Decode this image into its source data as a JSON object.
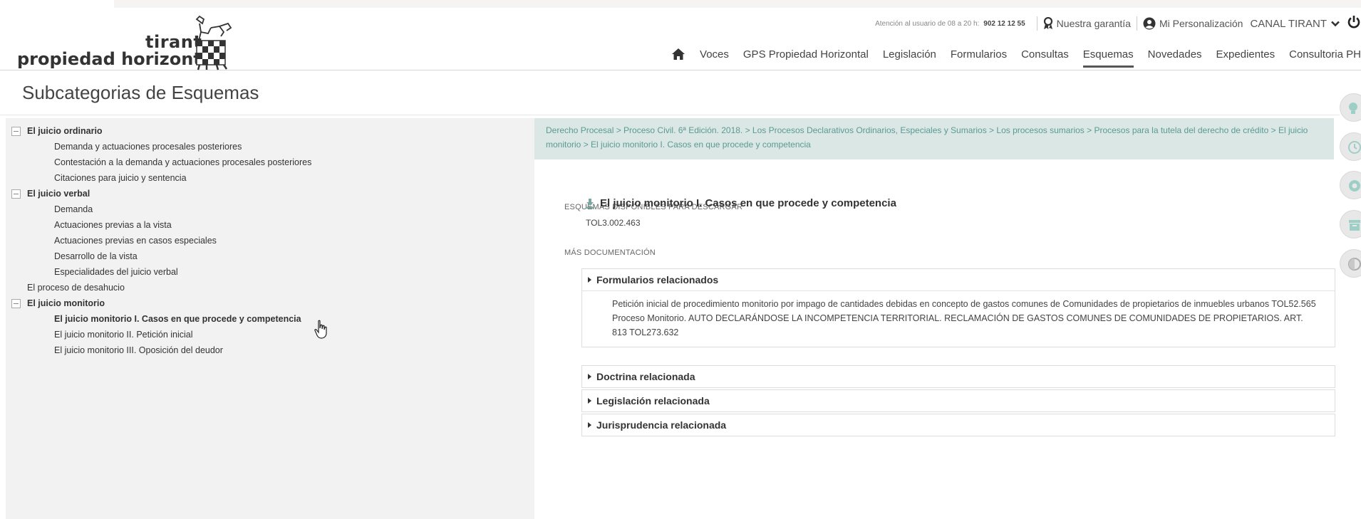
{
  "brand": {
    "line1": "tirant",
    "line2": "propiedad horizontal"
  },
  "utility": {
    "attention": "Atención al usuario de 08 a 20 h:",
    "phone": "902 12 12 55",
    "guarantee": "Nuestra garantía",
    "personalization": "Mi Personalización",
    "canal": "CANAL TIRANT"
  },
  "nav": {
    "items": [
      "Voces",
      "GPS Propiedad Horizontal",
      "Legislación",
      "Formularios",
      "Consultas",
      "Esquemas",
      "Novedades",
      "Expedientes",
      "Consultoria PH"
    ],
    "active": "Esquemas"
  },
  "page_title": "Subcategorias de Esquemas",
  "tree": {
    "groups": [
      {
        "label": "El juicio ordinario",
        "items": [
          "Demanda y actuaciones procesales posteriores",
          "Contestación a la demanda y actuaciones procesales posteriores",
          "Citaciones para juicio y sentencia"
        ]
      },
      {
        "label": "El juicio verbal",
        "items": [
          "Demanda",
          "Actuaciones previas a la vista",
          "Actuaciones previas en casos especiales",
          "Desarrollo de la vista",
          "Especialidades del juicio verbal"
        ]
      },
      {
        "label": "El proceso de desahucio"
      },
      {
        "label": "El juicio monitorio",
        "items": [
          "El juicio monitorio I. Casos en que procede y competencia",
          "El juicio monitorio II. Petición inicial",
          "El juicio monitorio III. Oposición del deudor"
        ]
      }
    ],
    "selected": "El juicio monitorio I. Casos en que procede y competencia"
  },
  "breadcrumb": "Derecho Procesal > Proceso Civil. 6ª Edición. 2018. > Los Procesos Declarativos Ordinarios, Especiales y Sumarios > Los procesos sumarios > Procesos para la tutela del derecho de crédito > El juicio monitorio > El juicio monitorio I. Casos en que procede y competencia",
  "downloads": {
    "label": "ESQUEMAS DISPONIBLES PARA DESCARGAR",
    "title": "El juicio monitorio I. Casos en que procede y competencia",
    "ref": "TOL3.002.463"
  },
  "more_docs": {
    "label": "MÁS DOCUMENTACIÓN",
    "sections": [
      {
        "title": "Formularios relacionados",
        "lines": [
          "Petición inicial de procedimiento monitorio por impago de cantidades debidas en concepto de gastos comunes de Comunidades de propietarios de inmuebles urbanos TOL52.565",
          "Proceso Monitorio. AUTO DECLARÁNDOSE LA INCOMPETENCIA TERRITORIAL. RECLAMACIÓN DE GASTOS COMUNES DE COMUNIDADES DE PROPIETARIOS. ART. 813 TOL273.632"
        ]
      },
      {
        "title": "Doctrina relacionada"
      },
      {
        "title": "Legislación relacionada"
      },
      {
        "title": "Jurisprudencia relacionada"
      }
    ]
  },
  "side_tools": [
    "lightbulb-icon",
    "clock-icon",
    "lifebuoy-icon",
    "archive-icon",
    "contrast-icon"
  ],
  "colors": {
    "breadcrumb_bg": "#dbe7e5",
    "breadcrumb_text": "#5a9a94",
    "tree_bg": "#f2f2f2",
    "side_icon": "#9ecfc6"
  }
}
